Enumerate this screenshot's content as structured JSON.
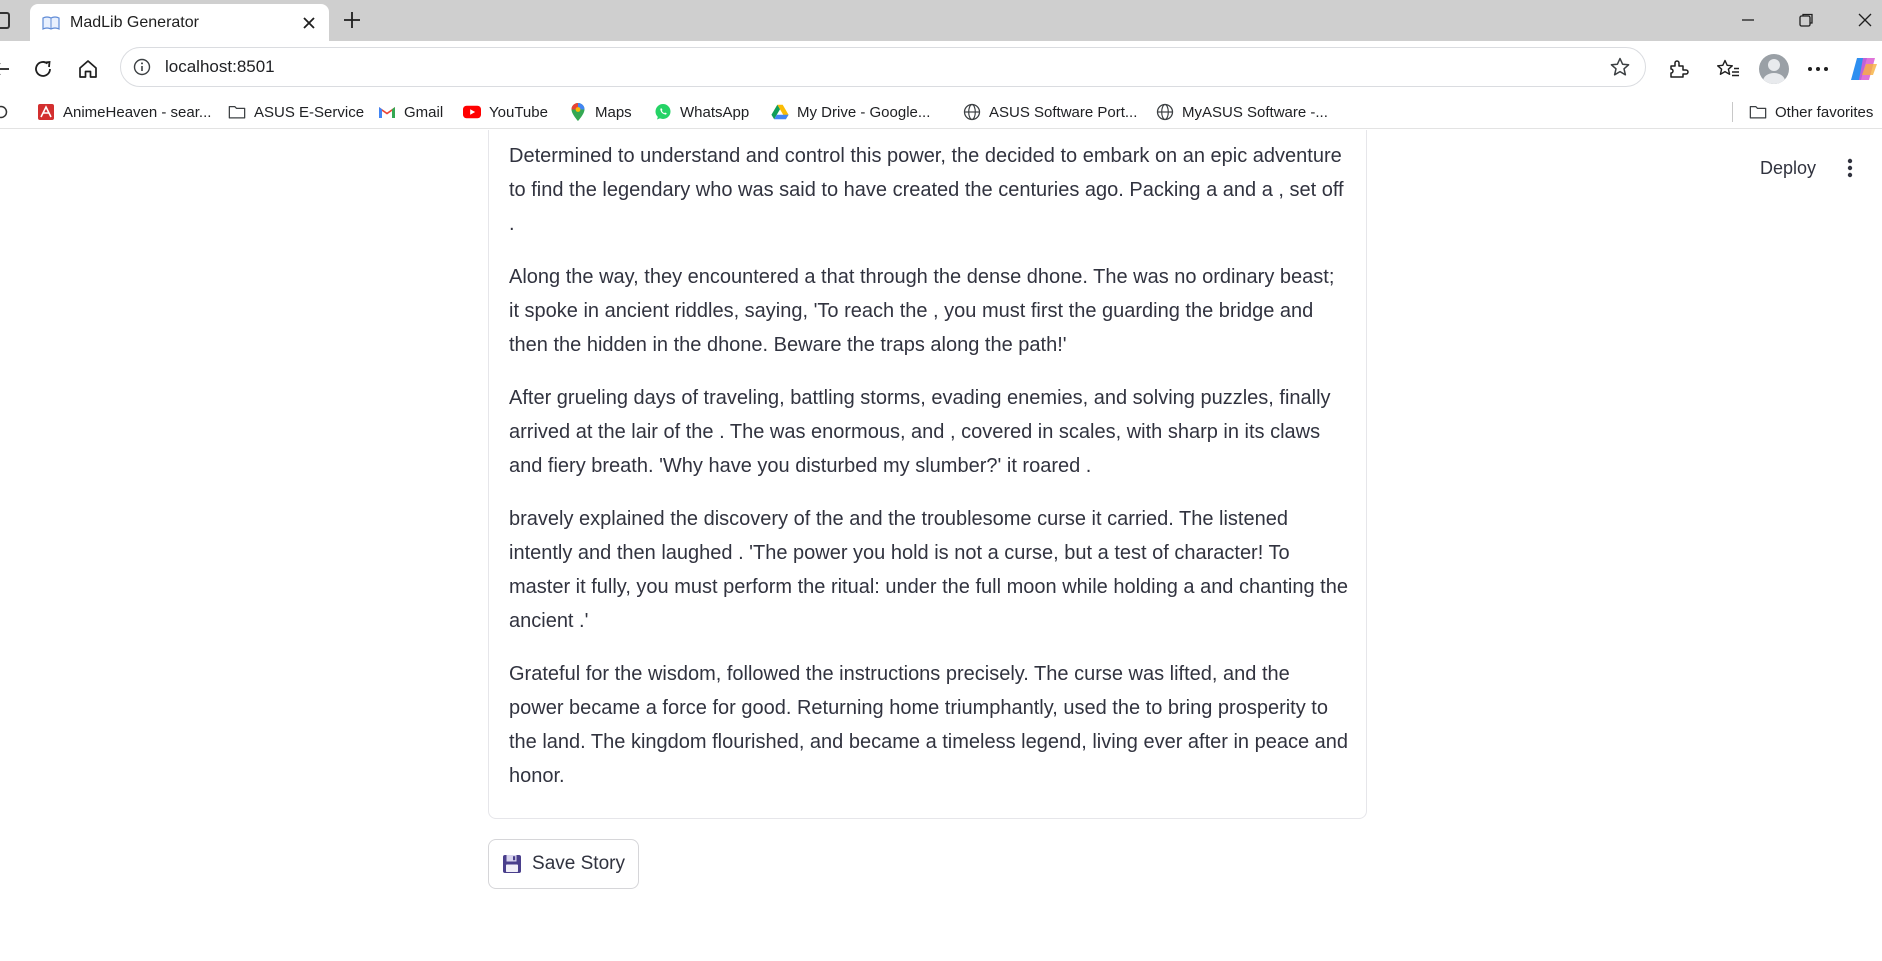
{
  "browser": {
    "tab": {
      "title": "MadLib Generator",
      "favicon": "book-icon"
    },
    "address": {
      "url": "localhost:8501"
    },
    "bookmarks": [
      {
        "label": "AnimeHeaven - sear...",
        "icon": "animeheaven-icon"
      },
      {
        "label": "ASUS E-Service",
        "icon": "folder-icon"
      },
      {
        "label": "Gmail",
        "icon": "gmail-icon"
      },
      {
        "label": "YouTube",
        "icon": "youtube-icon"
      },
      {
        "label": "Maps",
        "icon": "maps-icon"
      },
      {
        "label": "WhatsApp",
        "icon": "whatsapp-icon"
      },
      {
        "label": "My Drive - Google...",
        "icon": "drive-icon"
      },
      {
        "label": "ASUS Software Port...",
        "icon": "globe-icon"
      },
      {
        "label": "MyASUS Software -...",
        "icon": "globe-icon"
      }
    ],
    "other_favorites": "Other favorites"
  },
  "app": {
    "deploy_label": "Deploy",
    "story": [
      "Determined to understand and control this power, the decided to embark on an epic adventure to find the legendary who was said to have created the centuries ago. Packing a and a , set off .",
      "Along the way, they encountered a that through the dense dhone. The was no ordinary beast; it spoke in ancient riddles, saying, 'To reach the , you must first the guarding the bridge and then the hidden in the dhone. Beware the traps along the path!'",
      "After grueling days of traveling, battling storms, evading enemies, and solving puzzles, finally arrived at the lair of the . The was enormous, and , covered in scales, with sharp in its claws and fiery breath. 'Why have you disturbed my slumber?' it roared .",
      "bravely explained the discovery of the and the troublesome curse it carried. The listened intently and then laughed . 'The power you hold is not a curse, but a test of character! To master it fully, you must perform the ritual: under the full moon while holding a and chanting the ancient .'",
      "Grateful for the wisdom, followed the instructions precisely. The curse was lifted, and the power became a force for good. Returning home triumphantly, used the to bring prosperity to the land. The kingdom flourished, and became a timeless legend, living ever after in peace and honor."
    ],
    "save_button": {
      "label": "Save Story",
      "icon": "floppy-disk-icon"
    }
  },
  "colors": {
    "tabstrip": "#cfcfcf",
    "text": "#31333f",
    "card_border": "#e6e6ea"
  }
}
